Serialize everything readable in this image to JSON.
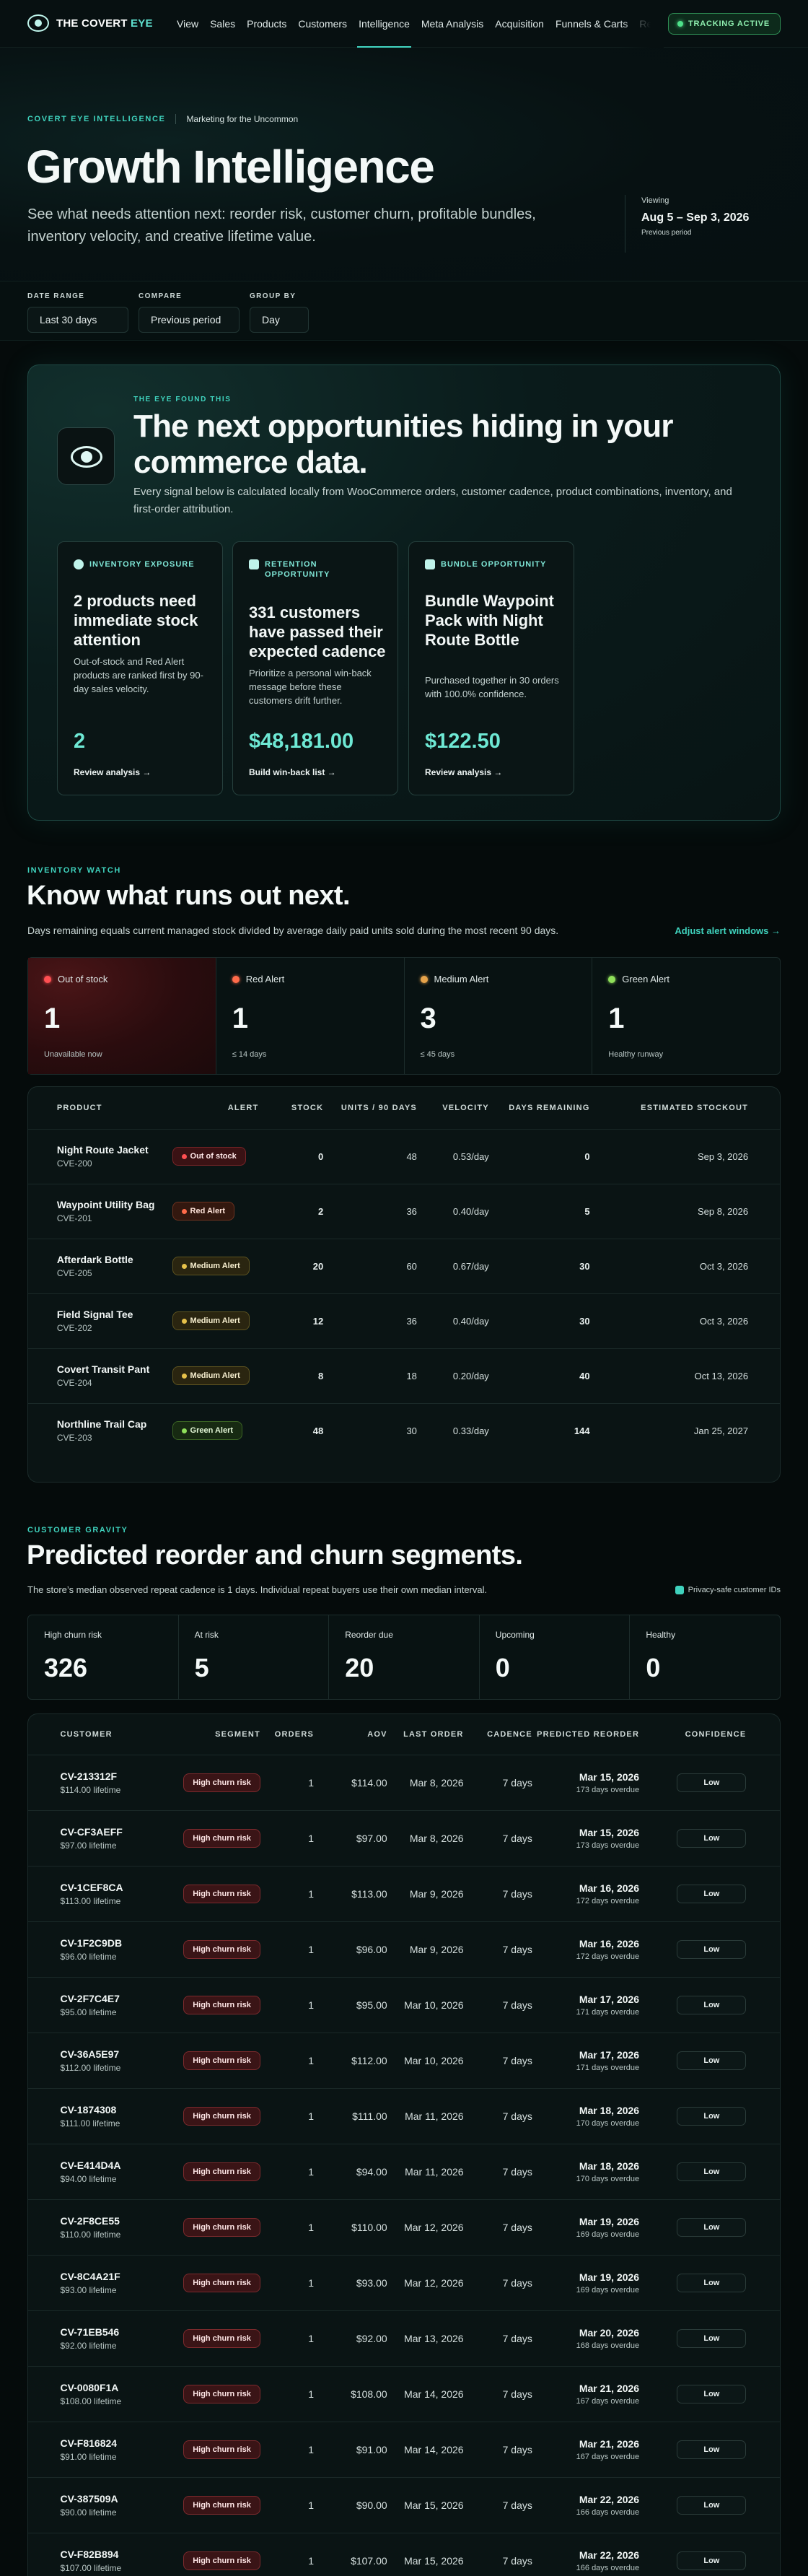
{
  "nav": {
    "brand_part1": "THE COVERT ",
    "brand_part2": "EYE",
    "items": [
      "View",
      "Sales",
      "Products",
      "Customers",
      "Intelligence",
      "Meta Analysis",
      "Acquisition",
      "Funnels & Carts",
      "Re"
    ],
    "active_index": 4,
    "tracking_label": "TRACKING ACTIVE"
  },
  "hero": {
    "eyebrow": "COVERT EYE INTELLIGENCE",
    "sub_eyebrow": "Marketing for the Uncommon",
    "title": "Growth Intelligence",
    "description": "See what needs attention next: reorder risk, customer churn, profitable bundles, inventory velocity, and creative lifetime value.",
    "viewing_label": "Viewing",
    "viewing_range": "Aug 5 – Sep 3, 2026",
    "viewing_compare": "Previous period"
  },
  "filters": {
    "date_range": {
      "label": "DATE RANGE",
      "value": "Last 30 days"
    },
    "compare": {
      "label": "COMPARE",
      "value": "Previous period"
    },
    "group_by": {
      "label": "GROUP BY",
      "value": "Day"
    }
  },
  "eye_found": {
    "eyebrow": "THE EYE FOUND THIS",
    "title": "The next opportunities hiding in your commerce data.",
    "description": "Every signal below is calculated locally from WooCommerce orders, customer cadence, product combinations, inventory, and first-order attribution.",
    "cards": [
      {
        "tag": "INVENTORY EXPOSURE",
        "title": "2 products need immediate stock attention",
        "body": "Out-of-stock and Red Alert products are ranked first by 90-day sales velocity.",
        "value": "2",
        "link": "Review analysis →"
      },
      {
        "tag": "RETENTION OPPORTUNITY",
        "title": "331 customers have passed their expected cadence",
        "body": "Prioritize a personal win-back message before these customers drift further.",
        "value": "$48,181.00",
        "link": "Build win-back list →"
      },
      {
        "tag": "BUNDLE OPPORTUNITY",
        "title": "Bundle Waypoint Pack with Night Route Bottle",
        "body": "Purchased together in 30 orders with 100.0% confidence.",
        "value": "$122.50",
        "link": "Review analysis →"
      }
    ]
  },
  "inventory": {
    "eyebrow": "INVENTORY WATCH",
    "title": "Know what runs out next.",
    "description": "Days remaining equals current managed stock divided by average daily paid units sold during the most recent 90 days.",
    "adjust_link": "Adjust alert windows →",
    "stats": [
      {
        "label": "Out of stock",
        "value": "1",
        "sub": "Unavailable now",
        "color": "#ff4f52"
      },
      {
        "label": "Red Alert",
        "value": "1",
        "sub": "≤ 14 days",
        "color": "#ff6b4a"
      },
      {
        "label": "Medium Alert",
        "value": "3",
        "sub": "≤ 45 days",
        "color": "#e6a34a"
      },
      {
        "label": "Green Alert",
        "value": "1",
        "sub": "Healthy runway",
        "color": "#8fe05a"
      }
    ],
    "columns": [
      "PRODUCT",
      "ALERT",
      "STOCK",
      "UNITS / 90 DAYS",
      "VELOCITY",
      "DAYS REMAINING",
      "ESTIMATED STOCKOUT"
    ],
    "rows": [
      {
        "name": "Night Route Jacket",
        "sku": "CVE-200",
        "alert": "Out of stock",
        "level": "out",
        "stock": "0",
        "units": "48",
        "velocity": "0.53/day",
        "days": "0",
        "stockout": "Sep 3, 2026"
      },
      {
        "name": "Waypoint Utility Bag",
        "sku": "CVE-201",
        "alert": "Red Alert",
        "level": "red",
        "stock": "2",
        "units": "36",
        "velocity": "0.40/day",
        "days": "5",
        "stockout": "Sep 8, 2026"
      },
      {
        "name": "Afterdark Bottle",
        "sku": "CVE-205",
        "alert": "Medium Alert",
        "level": "med",
        "stock": "20",
        "units": "60",
        "velocity": "0.67/day",
        "days": "30",
        "stockout": "Oct 3, 2026"
      },
      {
        "name": "Field Signal Tee",
        "sku": "CVE-202",
        "alert": "Medium Alert",
        "level": "med",
        "stock": "12",
        "units": "36",
        "velocity": "0.40/day",
        "days": "30",
        "stockout": "Oct 3, 2026"
      },
      {
        "name": "Covert Transit Pant",
        "sku": "CVE-204",
        "alert": "Medium Alert",
        "level": "med",
        "stock": "8",
        "units": "18",
        "velocity": "0.20/day",
        "days": "40",
        "stockout": "Oct 13, 2026"
      },
      {
        "name": "Northline Trail Cap",
        "sku": "CVE-203",
        "alert": "Green Alert",
        "level": "green",
        "stock": "48",
        "units": "30",
        "velocity": "0.33/day",
        "days": "144",
        "stockout": "Jan 25, 2027"
      }
    ]
  },
  "gravity": {
    "eyebrow": "CUSTOMER GRAVITY",
    "title": "Predicted reorder and churn segments.",
    "description": "The store’s median observed repeat cadence is 1 days. Individual repeat buyers use their own median interval.",
    "privacy_label": "Privacy-safe customer IDs",
    "stats": [
      {
        "label": "High churn risk",
        "value": "326"
      },
      {
        "label": "At risk",
        "value": "5"
      },
      {
        "label": "Reorder due",
        "value": "20"
      },
      {
        "label": "Upcoming",
        "value": "0"
      },
      {
        "label": "Healthy",
        "value": "0"
      }
    ],
    "columns": [
      "CUSTOMER",
      "SEGMENT",
      "ORDERS",
      "AOV",
      "LAST ORDER",
      "CADENCE",
      "PREDICTED REORDER",
      "CONFIDENCE"
    ],
    "rows": [
      {
        "id": "CV-213312F",
        "lifetime": "$114.00 lifetime",
        "segment": "High churn risk",
        "orders": "1",
        "aov": "$114.00",
        "last": "Mar 8, 2026",
        "cadence": "7 days",
        "predicted": "Mar 15, 2026",
        "overdue": "173 days overdue",
        "confidence": "Low"
      },
      {
        "id": "CV-CF3AEFF",
        "lifetime": "$97.00 lifetime",
        "segment": "High churn risk",
        "orders": "1",
        "aov": "$97.00",
        "last": "Mar 8, 2026",
        "cadence": "7 days",
        "predicted": "Mar 15, 2026",
        "overdue": "173 days overdue",
        "confidence": "Low"
      },
      {
        "id": "CV-1CEF8CA",
        "lifetime": "$113.00 lifetime",
        "segment": "High churn risk",
        "orders": "1",
        "aov": "$113.00",
        "last": "Mar 9, 2026",
        "cadence": "7 days",
        "predicted": "Mar 16, 2026",
        "overdue": "172 days overdue",
        "confidence": "Low"
      },
      {
        "id": "CV-1F2C9DB",
        "lifetime": "$96.00 lifetime",
        "segment": "High churn risk",
        "orders": "1",
        "aov": "$96.00",
        "last": "Mar 9, 2026",
        "cadence": "7 days",
        "predicted": "Mar 16, 2026",
        "overdue": "172 days overdue",
        "confidence": "Low"
      },
      {
        "id": "CV-2F7C4E7",
        "lifetime": "$95.00 lifetime",
        "segment": "High churn risk",
        "orders": "1",
        "aov": "$95.00",
        "last": "Mar 10, 2026",
        "cadence": "7 days",
        "predicted": "Mar 17, 2026",
        "overdue": "171 days overdue",
        "confidence": "Low"
      },
      {
        "id": "CV-36A5E97",
        "lifetime": "$112.00 lifetime",
        "segment": "High churn risk",
        "orders": "1",
        "aov": "$112.00",
        "last": "Mar 10, 2026",
        "cadence": "7 days",
        "predicted": "Mar 17, 2026",
        "overdue": "171 days overdue",
        "confidence": "Low"
      },
      {
        "id": "CV-1874308",
        "lifetime": "$111.00 lifetime",
        "segment": "High churn risk",
        "orders": "1",
        "aov": "$111.00",
        "last": "Mar 11, 2026",
        "cadence": "7 days",
        "predicted": "Mar 18, 2026",
        "overdue": "170 days overdue",
        "confidence": "Low"
      },
      {
        "id": "CV-E414D4A",
        "lifetime": "$94.00 lifetime",
        "segment": "High churn risk",
        "orders": "1",
        "aov": "$94.00",
        "last": "Mar 11, 2026",
        "cadence": "7 days",
        "predicted": "Mar 18, 2026",
        "overdue": "170 days overdue",
        "confidence": "Low"
      },
      {
        "id": "CV-2F8CE55",
        "lifetime": "$110.00 lifetime",
        "segment": "High churn risk",
        "orders": "1",
        "aov": "$110.00",
        "last": "Mar 12, 2026",
        "cadence": "7 days",
        "predicted": "Mar 19, 2026",
        "overdue": "169 days overdue",
        "confidence": "Low"
      },
      {
        "id": "CV-8C4A21F",
        "lifetime": "$93.00 lifetime",
        "segment": "High churn risk",
        "orders": "1",
        "aov": "$93.00",
        "last": "Mar 12, 2026",
        "cadence": "7 days",
        "predicted": "Mar 19, 2026",
        "overdue": "169 days overdue",
        "confidence": "Low"
      },
      {
        "id": "CV-71EB546",
        "lifetime": "$92.00 lifetime",
        "segment": "High churn risk",
        "orders": "1",
        "aov": "$92.00",
        "last": "Mar 13, 2026",
        "cadence": "7 days",
        "predicted": "Mar 20, 2026",
        "overdue": "168 days overdue",
        "confidence": "Low"
      },
      {
        "id": "CV-0080F1A",
        "lifetime": "$108.00 lifetime",
        "segment": "High churn risk",
        "orders": "1",
        "aov": "$108.00",
        "last": "Mar 14, 2026",
        "cadence": "7 days",
        "predicted": "Mar 21, 2026",
        "overdue": "167 days overdue",
        "confidence": "Low"
      },
      {
        "id": "CV-F816824",
        "lifetime": "$91.00 lifetime",
        "segment": "High churn risk",
        "orders": "1",
        "aov": "$91.00",
        "last": "Mar 14, 2026",
        "cadence": "7 days",
        "predicted": "Mar 21, 2026",
        "overdue": "167 days overdue",
        "confidence": "Low"
      },
      {
        "id": "CV-387509A",
        "lifetime": "$90.00 lifetime",
        "segment": "High churn risk",
        "orders": "1",
        "aov": "$90.00",
        "last": "Mar 15, 2026",
        "cadence": "7 days",
        "predicted": "Mar 22, 2026",
        "overdue": "166 days overdue",
        "confidence": "Low"
      },
      {
        "id": "CV-F82B894",
        "lifetime": "$107.00 lifetime",
        "segment": "High churn risk",
        "orders": "1",
        "aov": "$107.00",
        "last": "Mar 15, 2026",
        "cadence": "7 days",
        "predicted": "Mar 22, 2026",
        "overdue": "166 days overdue",
        "confidence": "Low"
      }
    ]
  }
}
